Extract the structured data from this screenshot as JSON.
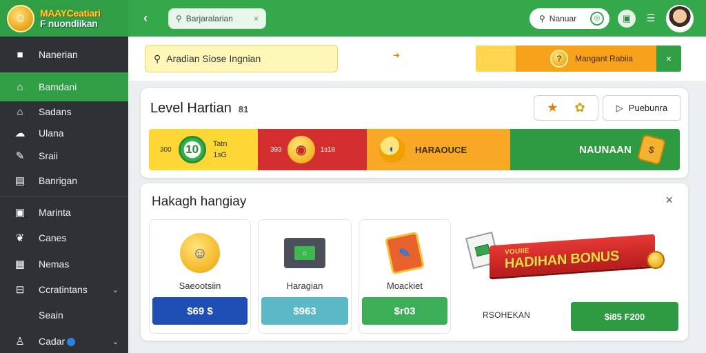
{
  "brand": {
    "line1": "MAAYCeatiari",
    "line2": "F nuondiikan"
  },
  "sidebar": {
    "items": [
      {
        "label": "Nanerian",
        "icon": "square-icon"
      },
      {
        "label": "Bamdani",
        "icon": "home-icon",
        "active": true
      },
      {
        "label": "Sadans",
        "icon": "house-icon"
      },
      {
        "label": "Ulana",
        "icon": "cloud-icon"
      },
      {
        "label": "Sraii",
        "icon": "pencil-icon"
      },
      {
        "label": "Banrigan",
        "icon": "document-icon"
      },
      {
        "label": "Marinta",
        "icon": "window-icon"
      },
      {
        "label": "Canes",
        "icon": "leaf-icon"
      },
      {
        "label": "Nemas",
        "icon": "grid-icon"
      },
      {
        "label": "Ccratintans",
        "icon": "minus-box-icon"
      },
      {
        "label": "Seain"
      },
      {
        "label": "Cadar",
        "icon": "user-icon"
      }
    ]
  },
  "topbar": {
    "back_icon": "chevron-left-icon",
    "search_text": "Barjaralarian",
    "search_clear": "×",
    "pill_text": "Nanuar",
    "pill_prefix": "⚲"
  },
  "search_row": {
    "search_text": "Aradian Siose Ingnian",
    "search_icon": "⚲",
    "promo_text": "Mangant Rabiia",
    "promo_coin": "?",
    "promo_close": "×"
  },
  "level": {
    "title": "Level Hartian",
    "count": "81",
    "button_right": "Puebunra",
    "tiers": {
      "t1": {
        "left_label": "300",
        "badge": "10",
        "right_top": "Tatn",
        "right_bottom": "1ɜG"
      },
      "t2": {
        "left_label": "393",
        "right_label": "1ɜ18"
      },
      "t3": {
        "label": "HARAOUCE"
      },
      "t4": {
        "label": "NAUNAAN"
      }
    }
  },
  "offers": {
    "title": "Hakagh hangiay",
    "close": "×",
    "products": [
      {
        "name": "Saeootsiin",
        "price": "$69 $"
      },
      {
        "name": "Haragian",
        "price": "$963"
      },
      {
        "name": "Moackiet",
        "price": "$r03"
      }
    ],
    "bonus": {
      "ribbon_small": "VOUIIE",
      "ribbon_main": "HADIHAN BONUS",
      "label": "RSOHEKAN",
      "button": "$i85 F200"
    }
  },
  "colors": {
    "green": "#2f9e45",
    "sidebar": "#2f3136",
    "yellow": "#fdd835",
    "red": "#d32f2f",
    "orange": "#f9a825",
    "blue": "#1f4fb4"
  }
}
